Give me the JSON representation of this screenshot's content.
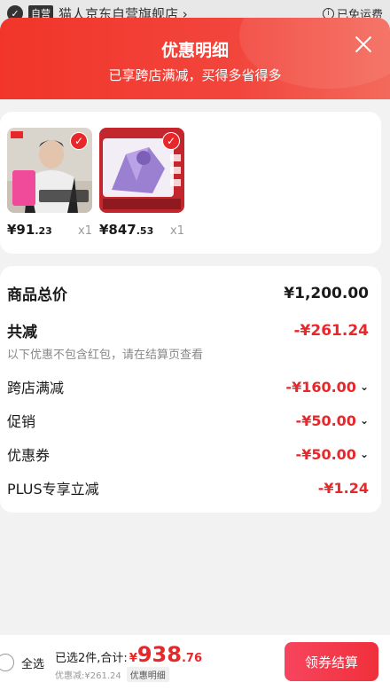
{
  "store": {
    "tag": "自营",
    "name": "猫人京东自营旗舰店",
    "chevron": "›",
    "shipping": "已免运费"
  },
  "header": {
    "title": "优惠明细",
    "subtitle": "已享跨店满减，买得多省得多"
  },
  "products": [
    {
      "price_int": "¥91",
      "price_dec": ".23",
      "qty": "x1"
    },
    {
      "price_int": "¥847",
      "price_dec": ".53",
      "qty": "x1"
    }
  ],
  "detail": {
    "total_label": "商品总价",
    "total_value": "¥1,200.00",
    "discount_label": "共减",
    "discount_value": "-¥261.24",
    "note": "以下优惠不包含红包，请在结算页查看",
    "items": [
      {
        "label": "跨店满减",
        "value": "-¥160.00",
        "caret": "⌄"
      },
      {
        "label": "促销",
        "value": "-¥50.00",
        "caret": "⌄"
      },
      {
        "label": "优惠券",
        "value": "-¥50.00",
        "caret": "⌄"
      },
      {
        "label": "PLUS专享立减",
        "value": "-¥1.24",
        "caret": ""
      }
    ]
  },
  "bottom": {
    "select_all": "全选",
    "selected_text": "已选2件,合计:",
    "yen": "¥",
    "amount_int": "938",
    "amount_dec": ".76",
    "discount_text": "优惠减:¥261.24",
    "detail_badge": "优惠明细",
    "checkout": "领券结算"
  },
  "colors": {
    "brand_red": "#e8272b",
    "header_red": "#f1352a"
  }
}
